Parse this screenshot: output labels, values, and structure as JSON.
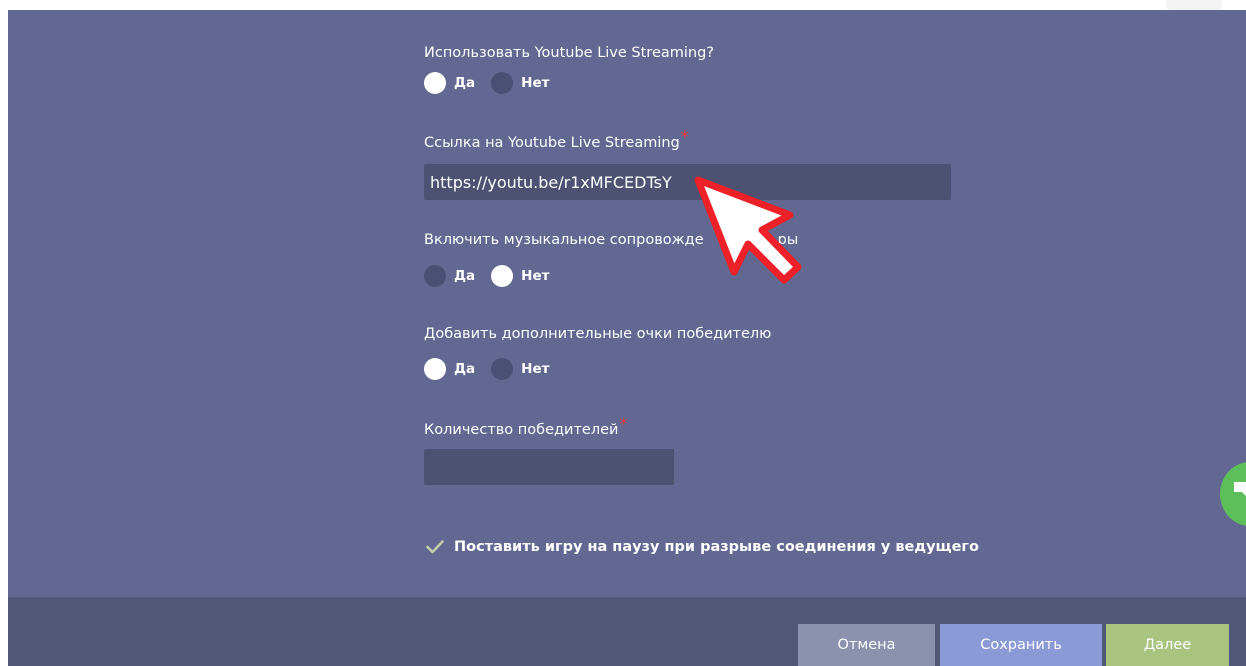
{
  "form": {
    "youtube_streaming": {
      "label": "Использовать Youtube Live Streaming?",
      "options": [
        "Да",
        "Нет"
      ],
      "selected": "Да"
    },
    "youtube_link": {
      "label": "Ссылка на Youtube Live Streaming",
      "required_mark": "*",
      "value": "https://youtu.be/r1xMFCEDTsY"
    },
    "music": {
      "label": "Включить музыкальное сопровожде",
      "label_tail": "ры",
      "options": [
        "Да",
        "Нет"
      ],
      "selected": "Нет"
    },
    "winner_points": {
      "label": "Добавить дополнительные очки победителю",
      "options": [
        "Да",
        "Нет"
      ],
      "selected": "Да"
    },
    "winners_count": {
      "label": "Количество победителей",
      "required_mark": "*",
      "value": ""
    },
    "pause_on_disconnect": {
      "label": "Поставить игру на паузу при разрыве соединения у ведущего",
      "checked": true
    }
  },
  "footer": {
    "cancel_label": "Отмена",
    "save_label": "Сохранить",
    "next_label": "Далее"
  },
  "colors": {
    "panel": "#626891",
    "footer": "#515776",
    "cancel": "#8c92ad",
    "save": "#8a9ad6",
    "next": "#a9c47f",
    "required": "#e63b3b",
    "chat": "#5dbf5a"
  },
  "icons": {
    "cursor": "cursor-arrow-icon",
    "check": "check-icon",
    "chat": "chat-icon"
  }
}
